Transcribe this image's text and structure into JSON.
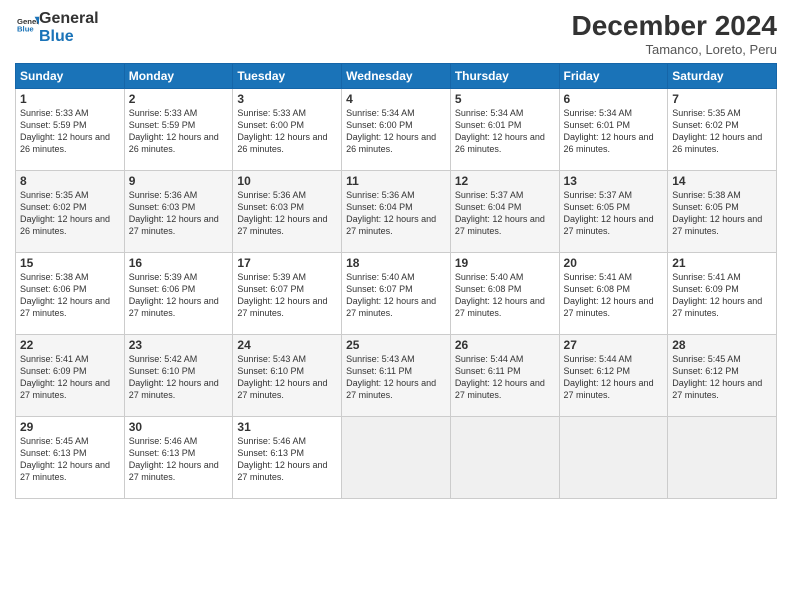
{
  "logo": {
    "line1": "General",
    "line2": "Blue"
  },
  "title": "December 2024",
  "subtitle": "Tamanco, Loreto, Peru",
  "days_header": [
    "Sunday",
    "Monday",
    "Tuesday",
    "Wednesday",
    "Thursday",
    "Friday",
    "Saturday"
  ],
  "weeks": [
    [
      {
        "day": "1",
        "sunrise": "Sunrise: 5:33 AM",
        "sunset": "Sunset: 5:59 PM",
        "daylight": "Daylight: 12 hours and 26 minutes."
      },
      {
        "day": "2",
        "sunrise": "Sunrise: 5:33 AM",
        "sunset": "Sunset: 5:59 PM",
        "daylight": "Daylight: 12 hours and 26 minutes."
      },
      {
        "day": "3",
        "sunrise": "Sunrise: 5:33 AM",
        "sunset": "Sunset: 6:00 PM",
        "daylight": "Daylight: 12 hours and 26 minutes."
      },
      {
        "day": "4",
        "sunrise": "Sunrise: 5:34 AM",
        "sunset": "Sunset: 6:00 PM",
        "daylight": "Daylight: 12 hours and 26 minutes."
      },
      {
        "day": "5",
        "sunrise": "Sunrise: 5:34 AM",
        "sunset": "Sunset: 6:01 PM",
        "daylight": "Daylight: 12 hours and 26 minutes."
      },
      {
        "day": "6",
        "sunrise": "Sunrise: 5:34 AM",
        "sunset": "Sunset: 6:01 PM",
        "daylight": "Daylight: 12 hours and 26 minutes."
      },
      {
        "day": "7",
        "sunrise": "Sunrise: 5:35 AM",
        "sunset": "Sunset: 6:02 PM",
        "daylight": "Daylight: 12 hours and 26 minutes."
      }
    ],
    [
      {
        "day": "8",
        "sunrise": "Sunrise: 5:35 AM",
        "sunset": "Sunset: 6:02 PM",
        "daylight": "Daylight: 12 hours and 26 minutes."
      },
      {
        "day": "9",
        "sunrise": "Sunrise: 5:36 AM",
        "sunset": "Sunset: 6:03 PM",
        "daylight": "Daylight: 12 hours and 27 minutes."
      },
      {
        "day": "10",
        "sunrise": "Sunrise: 5:36 AM",
        "sunset": "Sunset: 6:03 PM",
        "daylight": "Daylight: 12 hours and 27 minutes."
      },
      {
        "day": "11",
        "sunrise": "Sunrise: 5:36 AM",
        "sunset": "Sunset: 6:04 PM",
        "daylight": "Daylight: 12 hours and 27 minutes."
      },
      {
        "day": "12",
        "sunrise": "Sunrise: 5:37 AM",
        "sunset": "Sunset: 6:04 PM",
        "daylight": "Daylight: 12 hours and 27 minutes."
      },
      {
        "day": "13",
        "sunrise": "Sunrise: 5:37 AM",
        "sunset": "Sunset: 6:05 PM",
        "daylight": "Daylight: 12 hours and 27 minutes."
      },
      {
        "day": "14",
        "sunrise": "Sunrise: 5:38 AM",
        "sunset": "Sunset: 6:05 PM",
        "daylight": "Daylight: 12 hours and 27 minutes."
      }
    ],
    [
      {
        "day": "15",
        "sunrise": "Sunrise: 5:38 AM",
        "sunset": "Sunset: 6:06 PM",
        "daylight": "Daylight: 12 hours and 27 minutes."
      },
      {
        "day": "16",
        "sunrise": "Sunrise: 5:39 AM",
        "sunset": "Sunset: 6:06 PM",
        "daylight": "Daylight: 12 hours and 27 minutes."
      },
      {
        "day": "17",
        "sunrise": "Sunrise: 5:39 AM",
        "sunset": "Sunset: 6:07 PM",
        "daylight": "Daylight: 12 hours and 27 minutes."
      },
      {
        "day": "18",
        "sunrise": "Sunrise: 5:40 AM",
        "sunset": "Sunset: 6:07 PM",
        "daylight": "Daylight: 12 hours and 27 minutes."
      },
      {
        "day": "19",
        "sunrise": "Sunrise: 5:40 AM",
        "sunset": "Sunset: 6:08 PM",
        "daylight": "Daylight: 12 hours and 27 minutes."
      },
      {
        "day": "20",
        "sunrise": "Sunrise: 5:41 AM",
        "sunset": "Sunset: 6:08 PM",
        "daylight": "Daylight: 12 hours and 27 minutes."
      },
      {
        "day": "21",
        "sunrise": "Sunrise: 5:41 AM",
        "sunset": "Sunset: 6:09 PM",
        "daylight": "Daylight: 12 hours and 27 minutes."
      }
    ],
    [
      {
        "day": "22",
        "sunrise": "Sunrise: 5:41 AM",
        "sunset": "Sunset: 6:09 PM",
        "daylight": "Daylight: 12 hours and 27 minutes."
      },
      {
        "day": "23",
        "sunrise": "Sunrise: 5:42 AM",
        "sunset": "Sunset: 6:10 PM",
        "daylight": "Daylight: 12 hours and 27 minutes."
      },
      {
        "day": "24",
        "sunrise": "Sunrise: 5:43 AM",
        "sunset": "Sunset: 6:10 PM",
        "daylight": "Daylight: 12 hours and 27 minutes."
      },
      {
        "day": "25",
        "sunrise": "Sunrise: 5:43 AM",
        "sunset": "Sunset: 6:11 PM",
        "daylight": "Daylight: 12 hours and 27 minutes."
      },
      {
        "day": "26",
        "sunrise": "Sunrise: 5:44 AM",
        "sunset": "Sunset: 6:11 PM",
        "daylight": "Daylight: 12 hours and 27 minutes."
      },
      {
        "day": "27",
        "sunrise": "Sunrise: 5:44 AM",
        "sunset": "Sunset: 6:12 PM",
        "daylight": "Daylight: 12 hours and 27 minutes."
      },
      {
        "day": "28",
        "sunrise": "Sunrise: 5:45 AM",
        "sunset": "Sunset: 6:12 PM",
        "daylight": "Daylight: 12 hours and 27 minutes."
      }
    ],
    [
      {
        "day": "29",
        "sunrise": "Sunrise: 5:45 AM",
        "sunset": "Sunset: 6:13 PM",
        "daylight": "Daylight: 12 hours and 27 minutes."
      },
      {
        "day": "30",
        "sunrise": "Sunrise: 5:46 AM",
        "sunset": "Sunset: 6:13 PM",
        "daylight": "Daylight: 12 hours and 27 minutes."
      },
      {
        "day": "31",
        "sunrise": "Sunrise: 5:46 AM",
        "sunset": "Sunset: 6:13 PM",
        "daylight": "Daylight: 12 hours and 27 minutes."
      },
      null,
      null,
      null,
      null
    ]
  ]
}
